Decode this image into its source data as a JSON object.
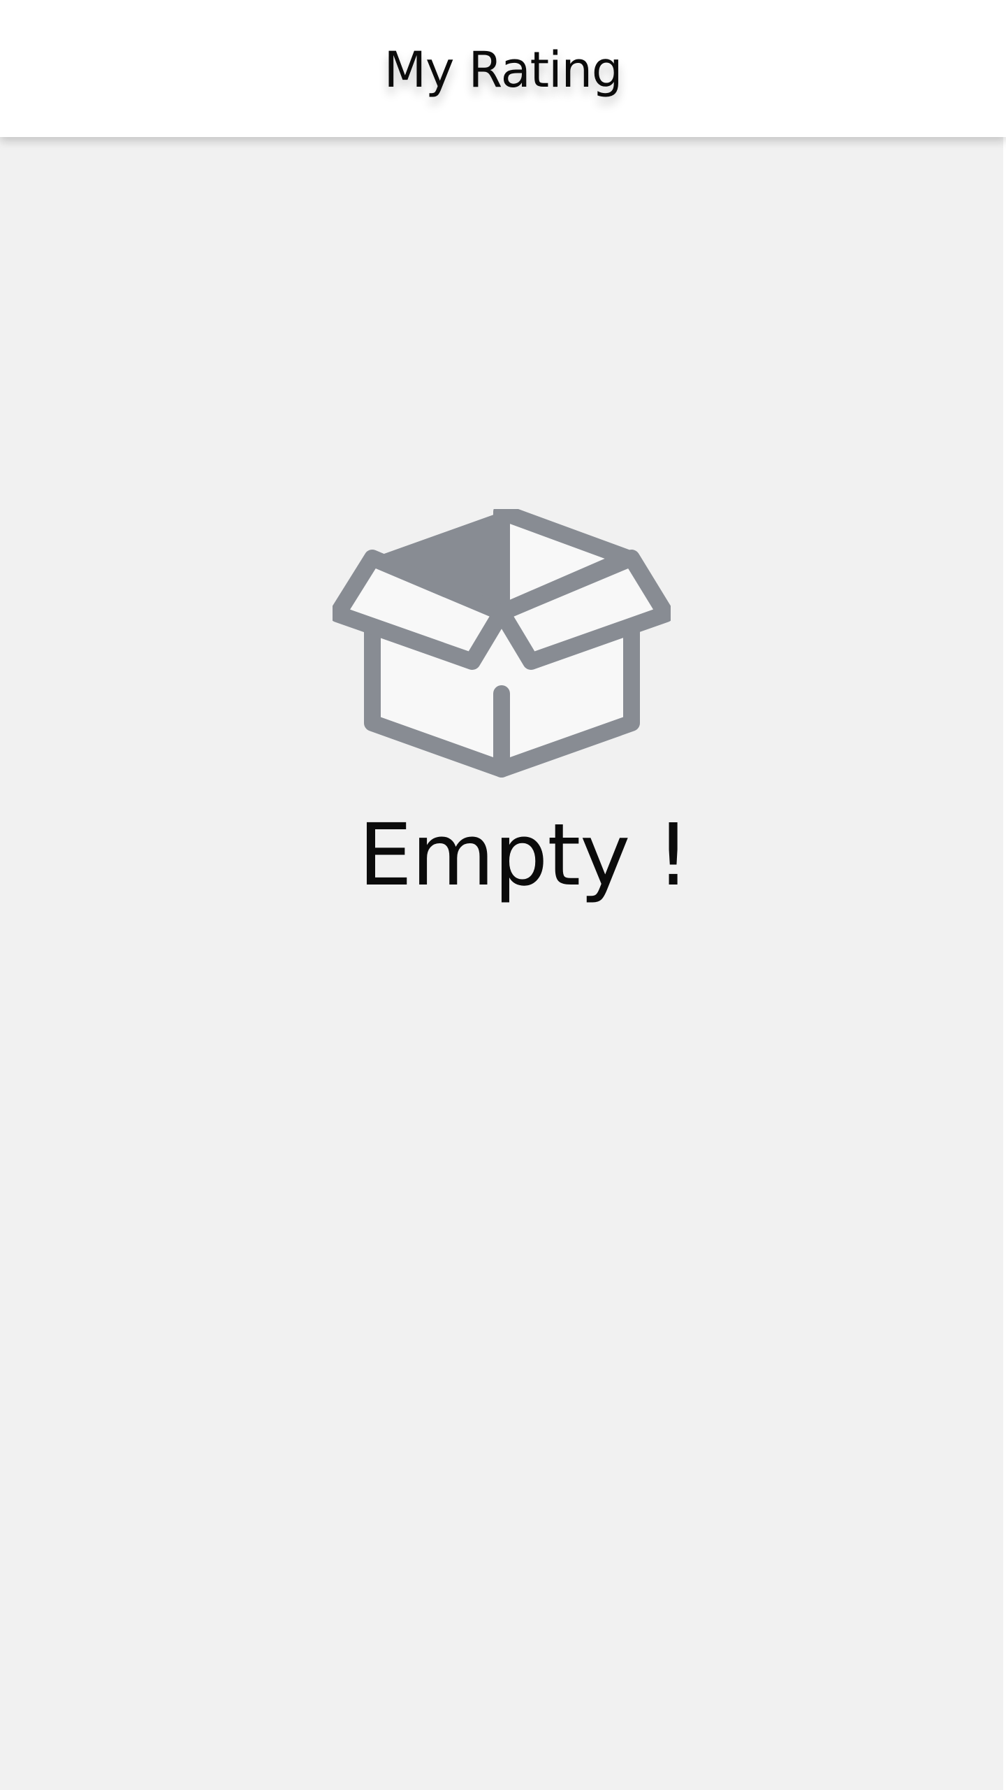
{
  "header": {
    "title": "My Rating"
  },
  "empty_state": {
    "icon": "open-box-icon",
    "message": "Empty !"
  },
  "colors": {
    "background": "#f1f1f1",
    "header_background": "#ffffff",
    "icon_stroke": "#888c93",
    "icon_fill": "#f8f8f8",
    "text": "#0b0b0b"
  }
}
